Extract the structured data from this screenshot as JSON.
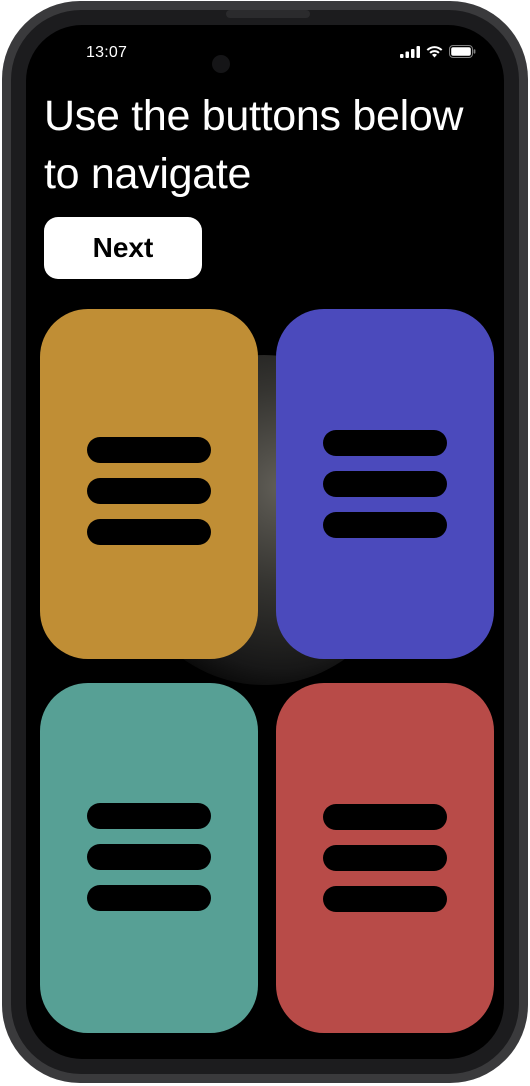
{
  "status_bar": {
    "time": "13:07",
    "icons": [
      "cellular-signal-icon",
      "wifi-icon",
      "battery-icon"
    ]
  },
  "headline": "Use the buttons below to navigate",
  "next_button": {
    "label": "Next"
  },
  "tiles": [
    {
      "icon": "hamburger-menu-icon",
      "color": "#C08E35"
    },
    {
      "icon": "hamburger-menu-icon",
      "color": "#4B4ABC"
    },
    {
      "icon": "hamburger-menu-icon",
      "color": "#57A095"
    },
    {
      "icon": "hamburger-menu-icon",
      "color": "#B84B48"
    }
  ],
  "colors": {
    "screen_background": "#000000",
    "text": "#FFFFFF",
    "button_background": "#FFFFFF",
    "button_text": "#000000",
    "device_frame": "#3A3A3C"
  }
}
